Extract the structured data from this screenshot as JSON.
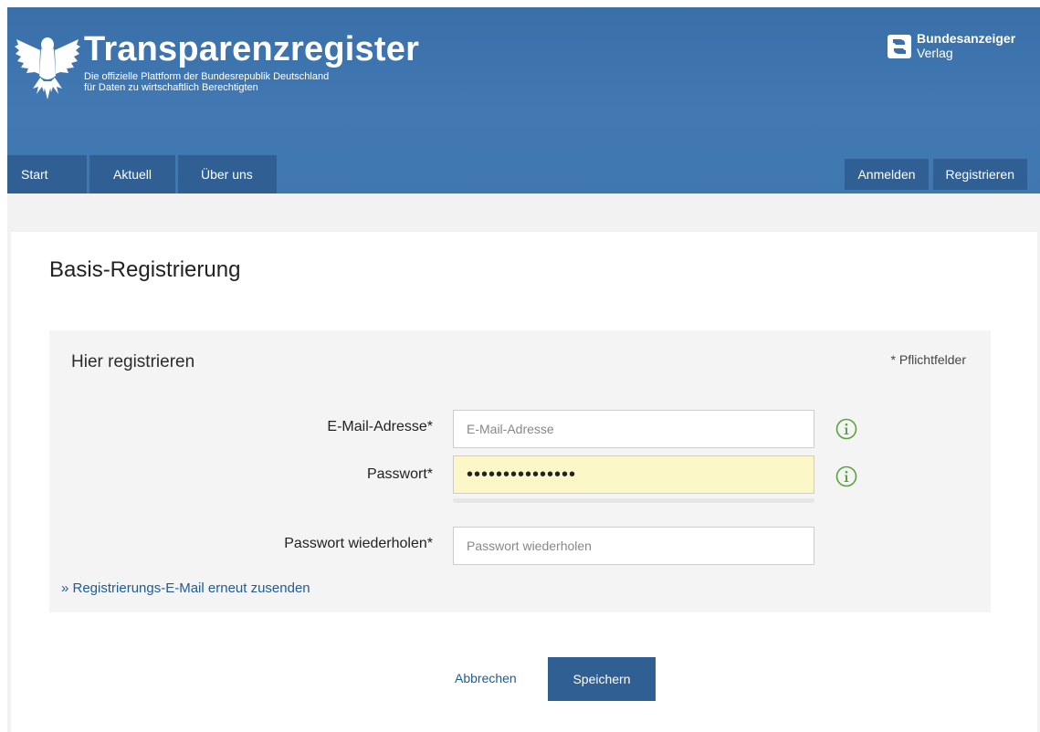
{
  "header": {
    "title": "Transparenzregister",
    "subtitle_line1": "Die offizielle Plattform der Bundesrepublik Deutschland",
    "subtitle_line2": "für Daten zu wirtschaftlich Berechtigten",
    "publisher_name": "Bundesanzeiger",
    "publisher_sub": "Verlag",
    "logo_icon": "federal-eagle-icon",
    "publisher_icon": "bundesanzeiger-logo-icon"
  },
  "nav": {
    "items": [
      "Start",
      "Aktuell",
      "Über uns"
    ],
    "login": "Anmelden",
    "register": "Registrieren"
  },
  "page": {
    "title": "Basis-Registrierung"
  },
  "form": {
    "section_title": "Hier registrieren",
    "required_note": "* Pflichtfelder",
    "email_label": "E-Mail-Adresse*",
    "email_placeholder": "E-Mail-Adresse",
    "password_label": "Passwort*",
    "password_value": "•••••••••••••••",
    "password_repeat_label": "Passwort wiederholen*",
    "password_repeat_placeholder": "Passwort wiederholen",
    "resend_link": "» Registrierungs-E-Mail erneut zusenden",
    "info_icon": "info-circle-icon"
  },
  "actions": {
    "cancel": "Abbrechen",
    "save": "Speichern"
  },
  "colors": {
    "header_blue": "#4279b3",
    "nav_blue": "#2f5f93",
    "link_blue": "#1f5b95",
    "info_green": "#5aa33b",
    "autofill_yellow": "#fbf7c6"
  }
}
